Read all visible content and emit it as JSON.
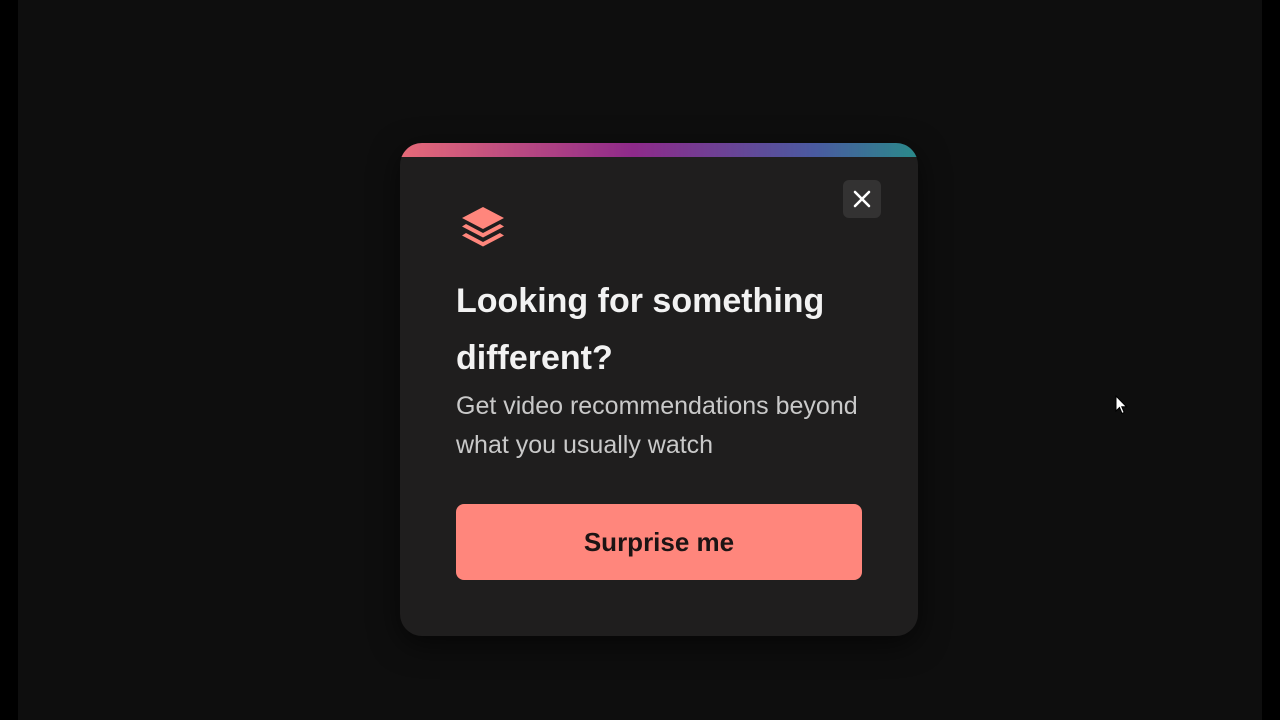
{
  "modal": {
    "title": "Looking for something different?",
    "subtitle": "Get video recommendations beyond what you usually watch",
    "cta_label": "Surprise me",
    "close_label": "Close",
    "logo_icon": "layers-icon",
    "close_icon": "close-icon"
  },
  "colors": {
    "background": "#0e0e0e",
    "modal_background": "#1f1e1e",
    "accent": "#ff867c",
    "gradient": [
      "#e0606e",
      "#8e2a8a",
      "#3f6fa0",
      "#2a8a8a"
    ]
  }
}
